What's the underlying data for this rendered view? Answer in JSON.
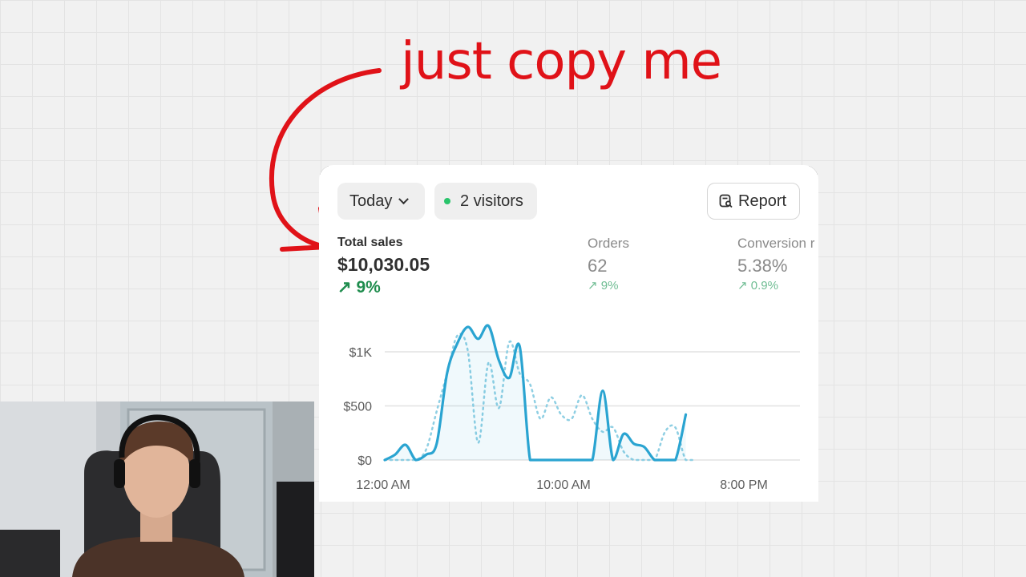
{
  "annotation": {
    "text": "just copy me",
    "color": "#e01218"
  },
  "toolbar": {
    "date_filter": "Today",
    "visitors_label": "2 visitors",
    "live_dot_color": "#29c46b",
    "report_label": "Report",
    "icons": {
      "dropdown": "chevron-down-icon",
      "report": "report-search-icon"
    }
  },
  "metrics": [
    {
      "label": "Total sales",
      "value": "$10,030.05",
      "delta": "9%",
      "active": true
    },
    {
      "label": "Orders",
      "value": "62",
      "delta": "9%",
      "active": false
    },
    {
      "label": "Conversion r",
      "value": "5.38%",
      "delta": "0.9%",
      "active": false
    }
  ],
  "chart_data": {
    "type": "line",
    "x_ticks": [
      "12:00 AM",
      "10:00 AM",
      "8:00 PM"
    ],
    "y_ticks": [
      "$0",
      "$500",
      "$1K"
    ],
    "ylim": [
      0,
      1300
    ],
    "grid": true,
    "colors": {
      "current": "#2aa4d1",
      "previous": "#8fcfe3"
    },
    "series": [
      {
        "style": "solid",
        "x": [
          0,
          1,
          2,
          3,
          4,
          5,
          6,
          7,
          8,
          9,
          10,
          11,
          12,
          13,
          14,
          15,
          16,
          17,
          18,
          19,
          20,
          21,
          22,
          23,
          24,
          25,
          26,
          27,
          28,
          29,
          30,
          31,
          32,
          33,
          34,
          35,
          36,
          37,
          38,
          39,
          40,
          41,
          42,
          43,
          44,
          45,
          46,
          47
        ],
        "values": [
          0,
          50,
          140,
          0,
          50,
          150,
          800,
          1080,
          1230,
          1120,
          1240,
          920,
          760,
          1050,
          0,
          0,
          0,
          0,
          0,
          0,
          0,
          640,
          0,
          240,
          150,
          120,
          0,
          0,
          0,
          420,
          0,
          0,
          0,
          0,
          0,
          0,
          0,
          0,
          0,
          0,
          0,
          0,
          0,
          0,
          0,
          0,
          0,
          0
        ]
      },
      {
        "style": "dotted",
        "x": [
          0,
          1,
          2,
          3,
          4,
          5,
          6,
          7,
          8,
          9,
          10,
          11,
          12,
          13,
          14,
          15,
          16,
          17,
          18,
          19,
          20,
          21,
          22,
          23,
          24,
          25,
          26,
          27,
          28,
          29,
          30
        ],
        "values": [
          0,
          0,
          0,
          0,
          100,
          450,
          800,
          1150,
          1010,
          160,
          900,
          480,
          1090,
          800,
          700,
          380,
          580,
          420,
          380,
          600,
          380,
          260,
          300,
          80,
          0,
          0,
          0,
          260,
          300,
          0,
          0
        ]
      }
    ]
  }
}
